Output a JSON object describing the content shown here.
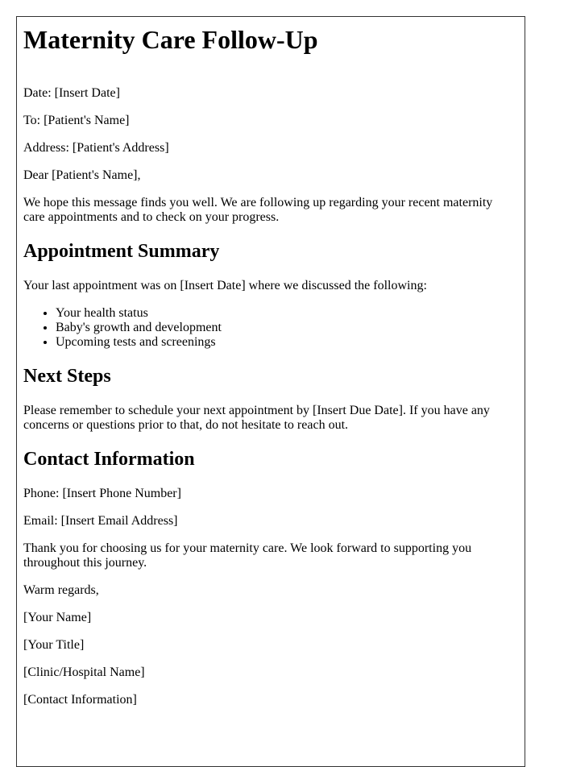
{
  "title": "Maternity Care Follow-Up",
  "header_fields": {
    "date": "Date: [Insert Date]",
    "to": "To: [Patient's Name]",
    "address": "Address: [Patient's Address]"
  },
  "salutation": "Dear [Patient's Name],",
  "intro": "We hope this message finds you well. We are following up regarding your recent maternity care appointments and to check on your progress.",
  "appointment_summary": {
    "heading": "Appointment Summary",
    "text": "Your last appointment was on [Insert Date] where we discussed the following:",
    "items": [
      "Your health status",
      "Baby's growth and development",
      "Upcoming tests and screenings"
    ]
  },
  "next_steps": {
    "heading": "Next Steps",
    "text": "Please remember to schedule your next appointment by [Insert Due Date]. If you have any concerns or questions prior to that, do not hesitate to reach out."
  },
  "contact_information": {
    "heading": "Contact Information",
    "phone": "Phone: [Insert Phone Number]",
    "email": "Email: [Insert Email Address]"
  },
  "closing_text": "Thank you for choosing us for your maternity care. We look forward to supporting you throughout this journey.",
  "sign_off": {
    "closing": "Warm regards,",
    "name": "[Your Name]",
    "title": "[Your Title]",
    "clinic": "[Clinic/Hospital Name]",
    "contact": "[Contact Information]"
  }
}
